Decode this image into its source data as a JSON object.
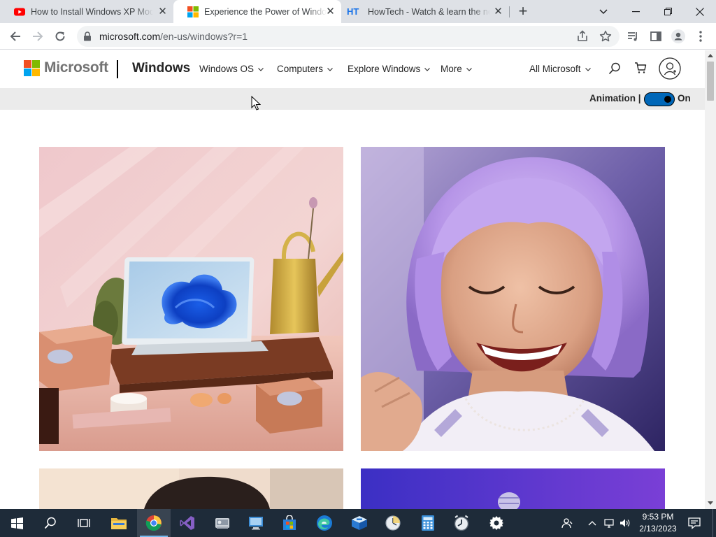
{
  "browser": {
    "tabs": [
      {
        "title": "How to Install Windows XP Mode",
        "favicon": "youtube-icon",
        "active": false
      },
      {
        "title": "Experience the Power of Windows",
        "favicon": "microsoft-icon",
        "active": true
      },
      {
        "title": "HowTech - Watch & learn the ne",
        "favicon": "howtech-icon",
        "favicon_text": "HT",
        "active": false
      }
    ],
    "new_tab_label": "+",
    "address": {
      "domain": "microsoft.com",
      "path": "/en-us/windows?r=1"
    }
  },
  "site": {
    "brand": "Microsoft",
    "product": "Windows",
    "nav": [
      {
        "label": "Windows OS"
      },
      {
        "label": "Computers"
      },
      {
        "label": "Explore Windows"
      },
      {
        "label": "More"
      }
    ],
    "all_microsoft": "All Microsoft",
    "animation_label": "Animation |",
    "animation_state": "On"
  },
  "tiles": [
    {
      "name": "laptop-still-life",
      "scene": "Windows laptop with blue bloom wallpaper on a wooden tray among pastries and a gold watering can"
    },
    {
      "name": "woman-portrait",
      "scene": "Smiling woman with lavender bob haircut"
    },
    {
      "name": "person-portrait-partial",
      "scene": "Person portrait, top partially visible"
    },
    {
      "name": "purple-gradient-partial",
      "scene": "Purple gradient background, top partially visible"
    }
  ],
  "taskbar": {
    "apps": [
      "start-icon",
      "search-icon",
      "task-view-icon",
      "file-explorer-icon",
      "chrome-icon",
      "visual-studio-icon",
      "disk-utility-icon",
      "remote-desktop-icon",
      "store-icon",
      "edge-icon",
      "virtualbox-icon",
      "clock-app-icon",
      "calculator-icon",
      "alarm-icon",
      "settings-icon"
    ],
    "time": "9:53 PM",
    "date": "2/13/2023"
  },
  "colors": {
    "ms_red": "#f25022",
    "ms_green": "#7fba00",
    "ms_blue": "#00a4ef",
    "ms_yellow": "#ffb900",
    "toggle_on": "#0067b8",
    "taskbar_bg": "#1e2b39"
  }
}
